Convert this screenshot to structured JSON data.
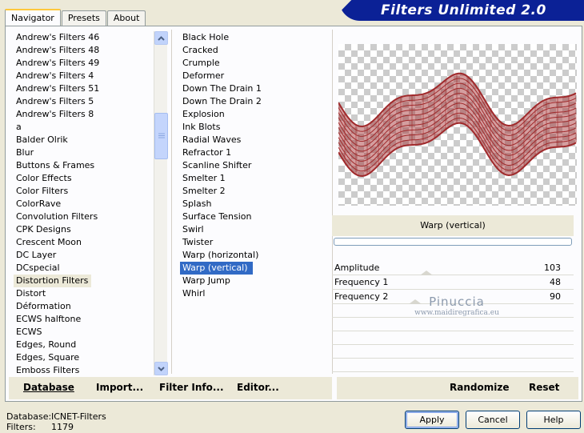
{
  "banner": {
    "title": "Filters Unlimited 2.0"
  },
  "tabs": [
    {
      "label": "Navigator",
      "active": true
    },
    {
      "label": "Presets",
      "active": false
    },
    {
      "label": "About",
      "active": false
    }
  ],
  "categories": {
    "items": [
      "Andrew's Filters 46",
      "Andrew's Filters 48",
      "Andrew's Filters 49",
      "Andrew's Filters 4",
      "Andrew's Filters 51",
      "Andrew's Filters 5",
      "Andrew's Filters 8",
      "a",
      "Balder Olrik",
      "Blur",
      "Buttons & Frames",
      "Color Effects",
      "Color Filters",
      "ColorRave",
      "Convolution Filters",
      "CPK Designs",
      "Crescent Moon",
      "DC Layer",
      "DCspecial",
      "Distortion Filters",
      "Distort",
      "Déformation",
      "ECWS halftone",
      "ECWS",
      "Edges, Round",
      "Edges, Square",
      "Emboss Filters"
    ],
    "selected": "Distortion Filters"
  },
  "filters": {
    "items": [
      "Black Hole",
      "Cracked",
      "Crumple",
      "Deformer",
      "Down The Drain 1",
      "Down The Drain 2",
      "Explosion",
      "Ink Blots",
      "Radial Waves",
      "Refractor 1",
      "Scanline Shifter",
      "Smelter 1",
      "Smelter 2",
      "Splash",
      "Surface Tension",
      "Swirl",
      "Twister",
      "Warp (horizontal)",
      "Warp (vertical)",
      "Warp Jump",
      "Whirl"
    ],
    "selected": "Warp (vertical)"
  },
  "preview": {
    "filter_name": "Warp (vertical)",
    "wave_color": "#a0292b"
  },
  "params": [
    {
      "label": "Amplitude",
      "value": "103"
    },
    {
      "label": "Frequency 1",
      "value": "48"
    },
    {
      "label": "Frequency 2",
      "value": "90"
    }
  ],
  "watermark": {
    "line1": "Pinuccia",
    "line2": "www.maidiregrafica.eu"
  },
  "actions": {
    "database": "Database",
    "import": "Import...",
    "filter_info": "Filter Info...",
    "editor": "Editor...",
    "randomize": "Randomize",
    "reset": "Reset"
  },
  "footer": {
    "database_label": "Database:",
    "database_value": "ICNET-Filters",
    "filters_label": "Filters:",
    "filters_value": "1179"
  },
  "buttons": {
    "apply": "Apply",
    "cancel": "Cancel",
    "help": "Help"
  }
}
